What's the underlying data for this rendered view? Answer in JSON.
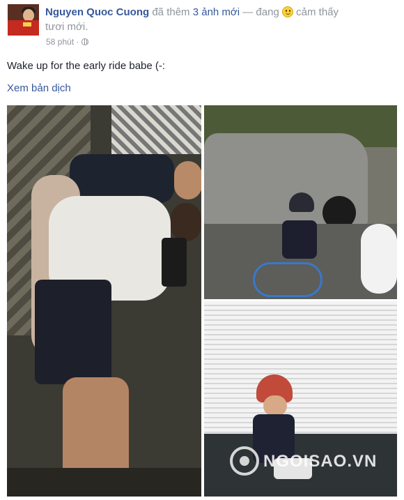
{
  "post": {
    "author": "Nguyen Quoc Cuong",
    "action_prefix": "đã thêm",
    "photo_count": "3 ảnh mới",
    "action_suffix": "— đang",
    "feeling_start": "cảm thấy",
    "feeling_end": "tươi mới.",
    "timestamp": "58 phút",
    "dot": "·",
    "audience_icon": "globe-icon",
    "status_text": "Wake up for the early ride babe (-:",
    "translate_link": "Xem bản dịch"
  },
  "photos": [
    {
      "name": "elevator-selfie-photo"
    },
    {
      "name": "boy-bicycle-street-photo"
    },
    {
      "name": "boy-bicycle-helmet-photo"
    }
  ],
  "watermark": {
    "text": "NGOISAO.VN"
  },
  "colors": {
    "link": "#365899",
    "text": "#1d2129",
    "meta": "#90949c"
  }
}
